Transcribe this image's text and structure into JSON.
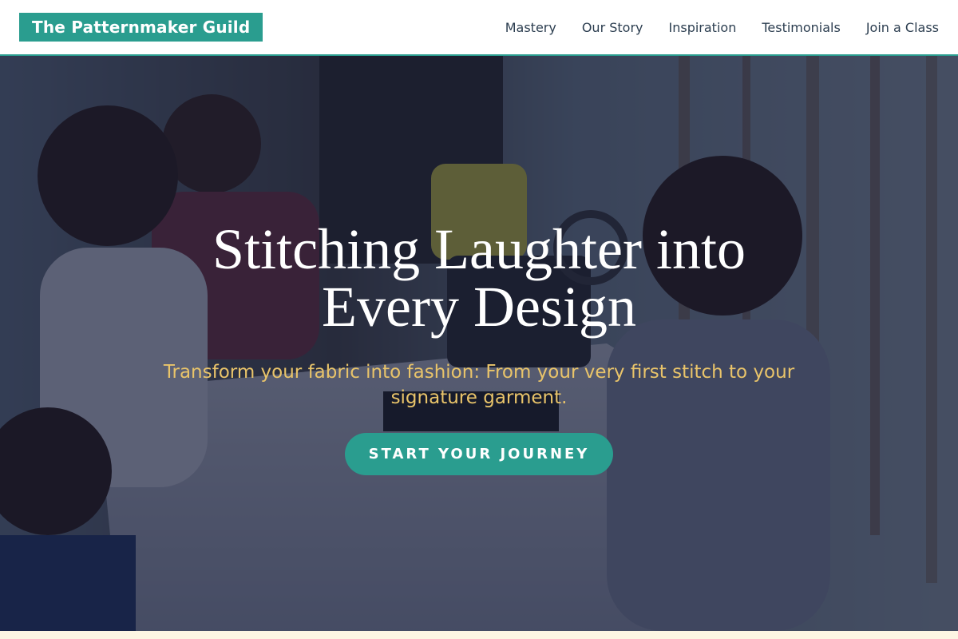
{
  "header": {
    "brand": "The Patternmaker Guild",
    "nav": [
      {
        "label": "Mastery"
      },
      {
        "label": "Our Story"
      },
      {
        "label": "Inspiration"
      },
      {
        "label": "Testimonials"
      },
      {
        "label": "Join a Class"
      }
    ]
  },
  "hero": {
    "title": "Stitching Laughter into Every Design",
    "subtitle": "Transform your fabric into fashion: From your very first stitch to your signature garment.",
    "cta_label": "START YOUR JOURNEY",
    "photo": "sewing-workshop-photo"
  },
  "colors": {
    "accent": "#2a9d8f",
    "subtitle": "#e9c46a",
    "nav_text": "#2c3e50",
    "overlay": "#121834"
  }
}
